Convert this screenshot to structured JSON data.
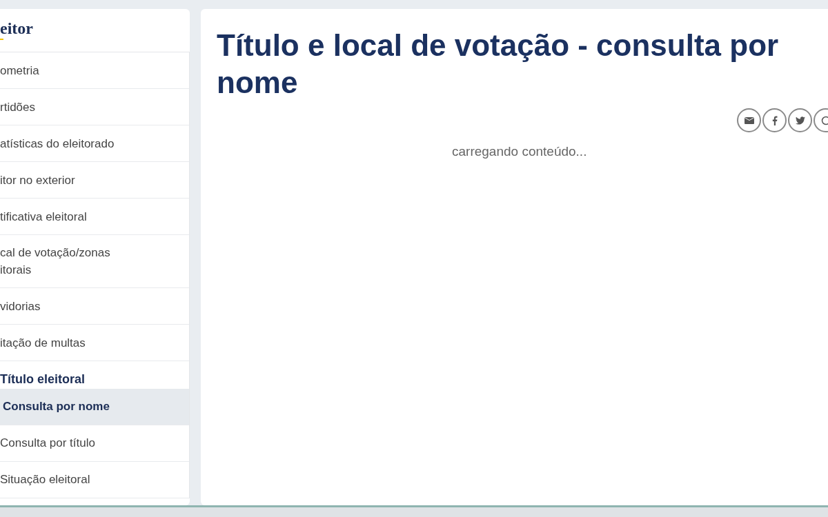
{
  "sidebar": {
    "title": "eitor",
    "items": [
      {
        "label": "ometria"
      },
      {
        "label": "rtidões"
      },
      {
        "label": "atísticas do eleitorado"
      },
      {
        "label": "itor no exterior"
      },
      {
        "label": "tificativa eleitoral"
      },
      {
        "label": "cal de votação/zonas\nitorais"
      },
      {
        "label": "vidorias"
      },
      {
        "label": "itação de multas"
      }
    ],
    "section": {
      "title": "Título eleitoral",
      "items": [
        {
          "label": "Consulta por nome",
          "selected": true
        },
        {
          "label": "Consulta por título",
          "selected": false
        },
        {
          "label": "Situação eleitoral",
          "selected": false
        }
      ]
    }
  },
  "main": {
    "title": "Título e local de votação - consulta por nome",
    "status": "carregando conteúdo..."
  }
}
